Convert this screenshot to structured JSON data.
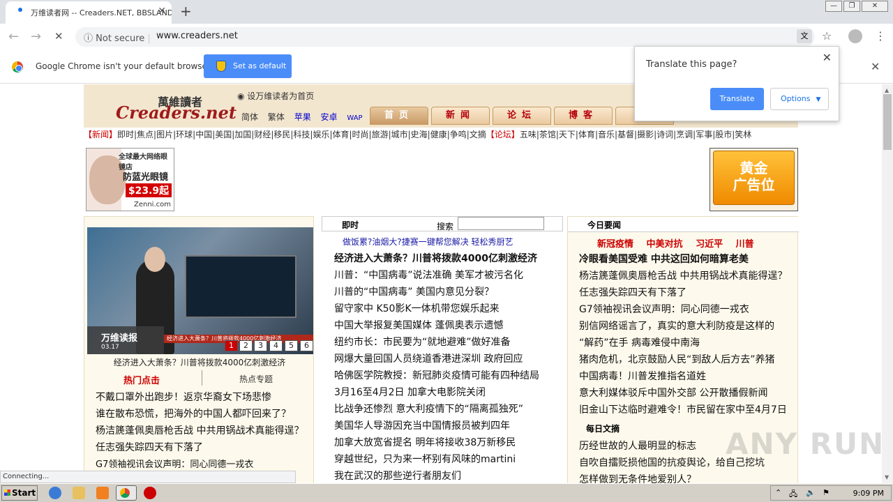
{
  "browser": {
    "tab_title": "万维读者网 -- Creaders.NET, BBSLAND...",
    "tab_close": "✕",
    "new_tab": "+",
    "win_min": "—",
    "win_max": "❐",
    "win_close": "✕",
    "back": "←",
    "forward": "→",
    "reload": "✕",
    "security_label": "Not secure",
    "url": "www.creaders.net",
    "bookmark_icon": "☆",
    "menu_icon": "⋮"
  },
  "infobar": {
    "message": "Google Chrome isn't your default browser",
    "button": "Set as default",
    "close": "✕"
  },
  "translate_popup": {
    "title": "Translate this page?",
    "close": "✕",
    "translate": "Translate",
    "options": "Options",
    "options_arrow": "▼"
  },
  "site": {
    "logo_cn": "萬維讀者",
    "logo_en": "Creaders.net",
    "home_link": "设万维读者为首页",
    "lang_links": [
      "简体",
      "繁体",
      "苹果",
      "安卓",
      "WAP"
    ],
    "nav_tabs": [
      "首页",
      "新闻",
      "论坛",
      "博客",
      "视"
    ],
    "category_row": "【新闻】即时|焦点|图片|环球|中国|美国|加国|财经|移民|科技|娱乐|体育|时尚|旅游|城市|史海|健康|争鸣|文摘【论坛】五味|茶馆|天下|体育|音乐|基督|摄影|诗词|烹调|军事|股市|笑林",
    "category_news": "【新闻】",
    "category_news_items": "即时|焦点|图片|环球|中国|美国|加国|财经|移民|科技|娱乐|体育|时尚|旅游|城市|史海|健康|争鸣|文摘",
    "category_forum": "【论坛】",
    "category_forum_items": "五味|茶馆|天下|体育|音乐|基督|摄影|诗词|烹调|军事|股市|笑林",
    "ad_left": {
      "line1": "全球最大网络眼镜店",
      "line2": "防蓝光眼镜",
      "price": "$23.9起",
      "brand": "Zenni.com"
    },
    "ad_right": {
      "line1": "黄金",
      "line2": "广告位"
    }
  },
  "left_col": {
    "video_brand": "万维读报",
    "video_date": "03.17",
    "video_ticker": "经济进入大萧条？川普将拨款4000亿刺激经济",
    "pages": [
      "1",
      "2",
      "3",
      "4",
      "5",
      "6"
    ],
    "caption": "经济进入大萧条？川普将拨款4000亿刺激经济",
    "hot_label": "热门点击",
    "topics_label": "热点专题",
    "items": [
      "不戴口罩外出跑步！返京华裔女下场悲惨",
      "谁在散布恐慌，把海外的中国人都吓回来了？",
      "杨洁篪蓬佩奥唇枪舌战 中共用锅战术真能得逞？",
      "任志强失踪四天有下落了",
      "G7领袖视讯会议声明：同心同德一戎衣"
    ]
  },
  "mid_col": {
    "header": "即时",
    "search_label": "搜索",
    "promo": "做饭累?油烟大?捷赛一键帮您解决 轻松秀厨艺",
    "items": [
      "经济进入大萧条？川普将拨款4000亿刺激经济",
      "川普：“中国病毒”说法准确 美军才被污名化",
      "川普的“中国病毒” 美国内意见分裂？",
      "留守家中 K50影K一体机带您娱乐起来",
      "中国大举报复美国媒体 蓬佩奥表示遗憾",
      "纽约市长：市民要为“就地避难”做好准备",
      "网爆大量回国人员绕道香港进深圳 政府回应",
      "哈佛医学院教授：新冠肺炎疫情可能有四种结局",
      "3月16至4月2日 加拿大电影院关闭",
      "比战争还惨烈 意大利疫情下的“隔离孤独死”",
      "美国华人导游因充当中国情报员被判四年",
      "加拿大放宽省提名 明年将接收38万新移民",
      "穿越世纪，只为来一杯别有风味的martini",
      "我在武汉的那些逆行者朋友们"
    ]
  },
  "right_col": {
    "header": "今日要闻",
    "keywords": [
      "新冠疫情",
      "中美对抗",
      "习近平",
      "川普"
    ],
    "items": [
      "冷眼看美国受难 中共这回如何暗算老美",
      "杨洁篪蓬佩奥唇枪舌战 中共用锅战术真能得逞？",
      "任志强失踪四天有下落了",
      "G7领袖视讯会议声明：同心同德一戎衣",
      "别信网络谣言了，真实的意大利防疫是这样的",
      "“解药”在手 病毒难侵中南海",
      "猪肉危机，北京鼓励人民“到敌人后方去”养猪",
      "中国病毒！川普发推指名道姓",
      "意大利媒体驳斥中国外交部 公开散播假新闻",
      "旧金山下达临时避难令！市民留在家中至4月7日"
    ],
    "section2": "每日文摘",
    "items2": [
      "历经世故的人最明显的标志",
      "自吹自擂贬损他国的抗疫舆论，给自己挖坑",
      "怎样做到无条件地爱别人？"
    ]
  },
  "status": "Connecting...",
  "watermark": "ANY RUN",
  "taskbar": {
    "start": "Start",
    "clock": "9:09 PM"
  }
}
